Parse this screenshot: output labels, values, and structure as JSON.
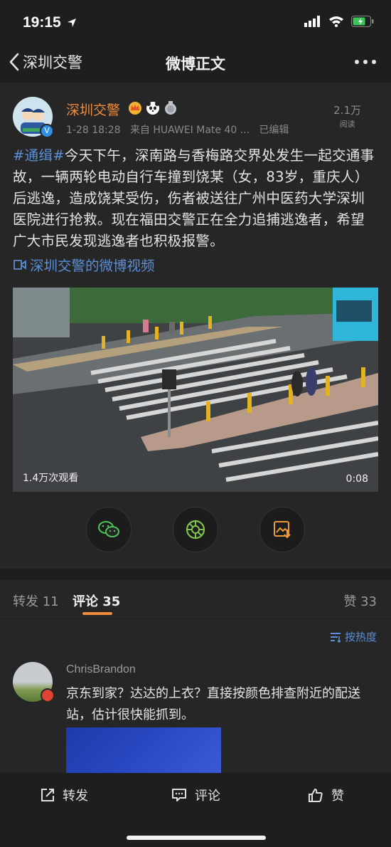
{
  "status_bar": {
    "time": "19:15"
  },
  "nav": {
    "back_label": "深圳交警",
    "title": "微博正文"
  },
  "post": {
    "author": "深圳交警",
    "date": "1-28 18:28",
    "source": "来自 HUAWEI Mate 40 ...",
    "edited": "已编辑",
    "read_count": "2.1万",
    "read_label": "阅读",
    "hashtag": "#通缉#",
    "text": "今天下午，深南路与香梅路交界处发生一起交通事故，一辆两轮电动自行车撞到饶某（女，83岁，重庆人）后逃逸，造成饶某受伤，伤者被送往广州中医药大学深圳医院进行抢救。现在福田交警正在全力追捕逃逸者，希望广大市民发现逃逸者也积极报警。",
    "video_link": "深圳交警的微博视频",
    "video_views": "1.4万次观看",
    "video_duration": "0:08"
  },
  "tabs": {
    "repost": "转发 11",
    "comments": "评论 35",
    "likes": "赞 33"
  },
  "comments": {
    "sort_label": "按热度",
    "items": [
      {
        "name": "ChrisBrandon",
        "text": "京东到家？达达的上衣？直接按颜色排查附近的配送站，估计很快能抓到。"
      }
    ]
  },
  "bottom_bar": {
    "repost": "转发",
    "comment": "评论",
    "like": "赞"
  },
  "colors": {
    "background": "#1e1e1e",
    "card": "#262626",
    "accent_orange": "#f08c3c",
    "link_blue": "#5b8fd6"
  },
  "icons": [
    "back-chevron-icon",
    "more-icon",
    "verified-icon",
    "video-link-icon",
    "wechat-icon",
    "moments-icon",
    "save-image-icon",
    "sort-icon",
    "repost-icon",
    "comment-icon",
    "like-icon"
  ]
}
